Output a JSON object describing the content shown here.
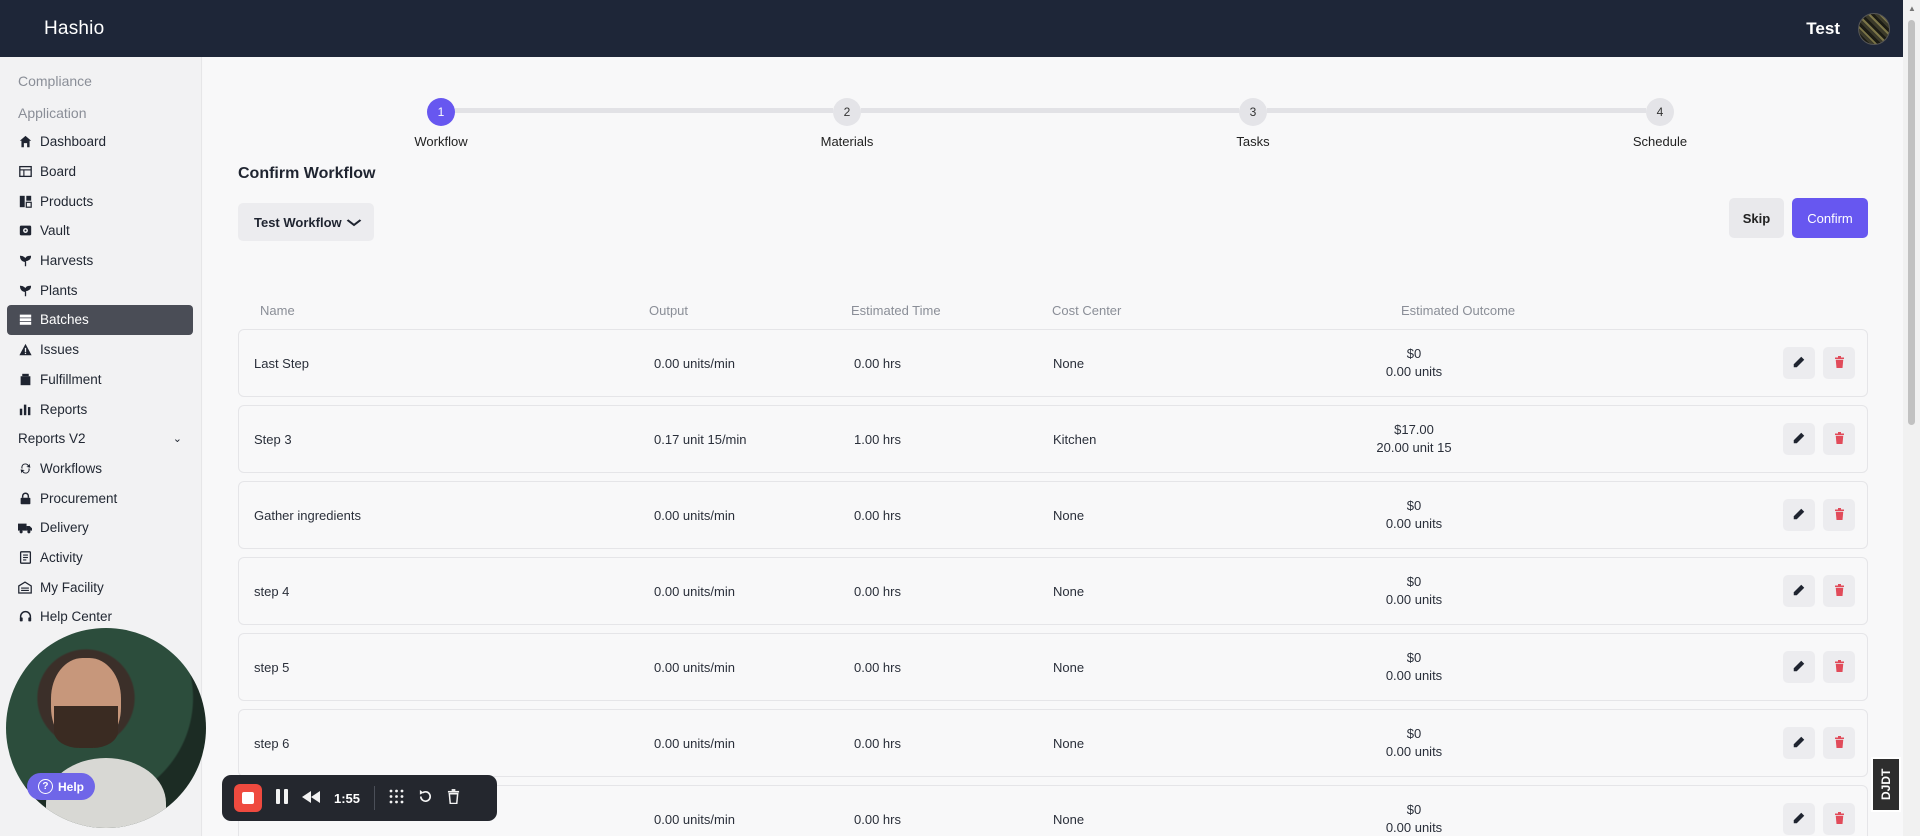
{
  "app": {
    "brand": "Hashio",
    "user": "Test"
  },
  "sidebar": {
    "sections": [
      "Compliance",
      "Application"
    ],
    "items": [
      {
        "label": "Dashboard",
        "icon": "home-icon"
      },
      {
        "label": "Board",
        "icon": "board-icon"
      },
      {
        "label": "Products",
        "icon": "products-icon"
      },
      {
        "label": "Vault",
        "icon": "vault-icon"
      },
      {
        "label": "Harvests",
        "icon": "harvest-icon"
      },
      {
        "label": "Plants",
        "icon": "plant-icon"
      },
      {
        "label": "Batches",
        "icon": "batches-icon",
        "active": true
      },
      {
        "label": "Issues",
        "icon": "warning-icon"
      },
      {
        "label": "Fulfillment",
        "icon": "fulfillment-icon"
      },
      {
        "label": "Reports",
        "icon": "bar-chart-icon"
      },
      {
        "label": "Reports V2",
        "icon": "",
        "expandable": true
      },
      {
        "label": "Workflows",
        "icon": "workflow-icon"
      },
      {
        "label": "Procurement",
        "icon": "lock-icon"
      },
      {
        "label": "Delivery",
        "icon": "truck-icon"
      },
      {
        "label": "Activity",
        "icon": "activity-icon"
      },
      {
        "label": "My Facility",
        "icon": "facility-icon"
      },
      {
        "label": "Help Center",
        "icon": "headset-icon"
      }
    ]
  },
  "stepper": {
    "steps": [
      {
        "num": "1",
        "label": "Workflow",
        "active": true
      },
      {
        "num": "2",
        "label": "Materials"
      },
      {
        "num": "3",
        "label": "Tasks"
      },
      {
        "num": "4",
        "label": "Schedule"
      }
    ]
  },
  "page": {
    "title": "Confirm Workflow",
    "workflow_select": "Test Workflow",
    "skip_label": "Skip",
    "confirm_label": "Confirm",
    "accent": "#6757f0"
  },
  "table": {
    "headers": [
      "Name",
      "Output",
      "Estimated Time",
      "Cost Center",
      "Estimated Outcome"
    ],
    "rows": [
      {
        "name": "Last Step",
        "output": "0.00 units/min",
        "time": "0.00 hrs",
        "cost_center": "None",
        "outcome_cost": "$0",
        "outcome_units": "0.00 units"
      },
      {
        "name": "Step 3",
        "output": "0.17 unit 15/min",
        "time": "1.00 hrs",
        "cost_center": "Kitchen",
        "outcome_cost": "$17.00",
        "outcome_units": "20.00 unit 15"
      },
      {
        "name": "Gather ingredients",
        "output": "0.00 units/min",
        "time": "0.00 hrs",
        "cost_center": "None",
        "outcome_cost": "$0",
        "outcome_units": "0.00 units"
      },
      {
        "name": "step 4",
        "output": "0.00 units/min",
        "time": "0.00 hrs",
        "cost_center": "None",
        "outcome_cost": "$0",
        "outcome_units": "0.00 units"
      },
      {
        "name": "step 5",
        "output": "0.00 units/min",
        "time": "0.00 hrs",
        "cost_center": "None",
        "outcome_cost": "$0",
        "outcome_units": "0.00 units"
      },
      {
        "name": "step 6",
        "output": "0.00 units/min",
        "time": "0.00 hrs",
        "cost_center": "None",
        "outcome_cost": "$0",
        "outcome_units": "0.00 units"
      },
      {
        "name": "",
        "output": "0.00 units/min",
        "time": "0.00 hrs",
        "cost_center": "None",
        "outcome_cost": "$0",
        "outcome_units": "0.00 units"
      }
    ]
  },
  "overlay": {
    "help_label": "Help",
    "recording_time": "1:55",
    "badge_text": "DJDT"
  }
}
